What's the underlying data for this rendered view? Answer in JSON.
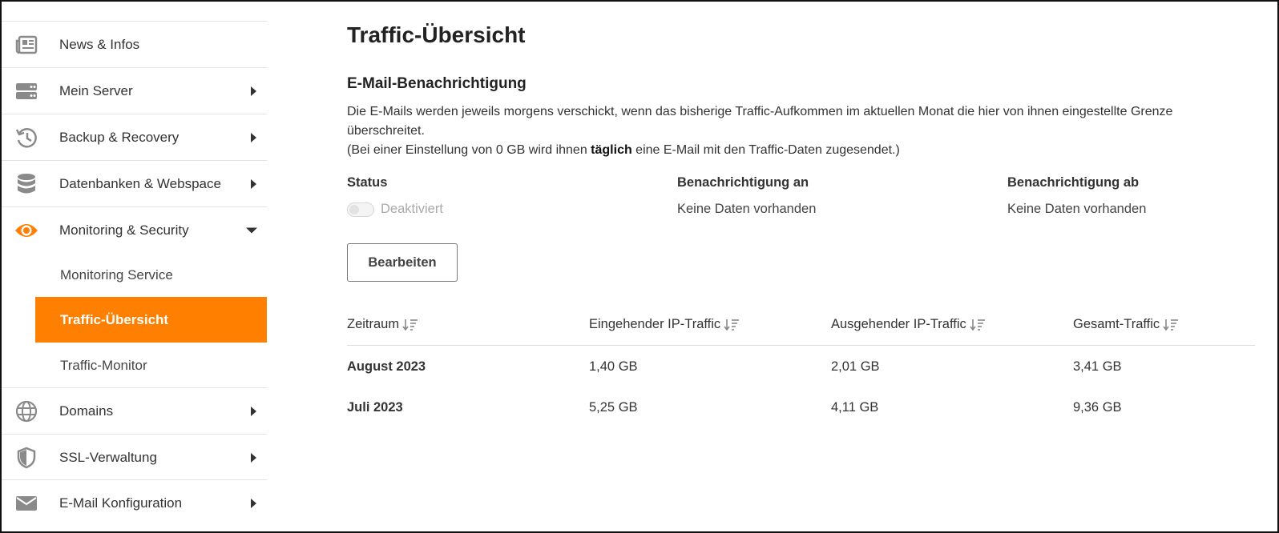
{
  "sidebar": {
    "items": [
      {
        "label": "News & Infos",
        "icon": "newspaper-icon"
      },
      {
        "label": "Mein Server",
        "icon": "server-icon"
      },
      {
        "label": "Backup & Recovery",
        "icon": "history-icon"
      },
      {
        "label": "Datenbanken & Webspace",
        "icon": "database-icon"
      },
      {
        "label": "Monitoring & Security",
        "icon": "eye-icon"
      },
      {
        "label": "Domains",
        "icon": "globe-icon"
      },
      {
        "label": "SSL-Verwaltung",
        "icon": "shield-icon"
      },
      {
        "label": "E-Mail Konfiguration",
        "icon": "envelope-icon"
      }
    ],
    "subitems": [
      {
        "label": "Monitoring Service",
        "active": false
      },
      {
        "label": "Traffic-Übersicht",
        "active": true
      },
      {
        "label": "Traffic-Monitor",
        "active": false
      }
    ]
  },
  "main": {
    "title": "Traffic-Übersicht",
    "section_title": "E-Mail-Benachrichtigung",
    "desc_line1": "Die E-Mails werden jeweils morgens verschickt, wenn das bisherige Traffic-Aufkommen im aktuellen Monat die hier von ihnen eingestellte Grenze überschreitet.",
    "desc_line2_pre": "(Bei einer Einstellung von 0 GB wird ihnen ",
    "desc_line2_bold": "täglich",
    "desc_line2_post": " eine E-Mail mit den Traffic-Daten zugesendet.)",
    "status": {
      "status_header": "Status",
      "status_value": "Deaktiviert",
      "notify_on_header": "Benachrichtigung an",
      "notify_on_value": "Keine Daten vorhanden",
      "notify_off_header": "Benachrichtigung ab",
      "notify_off_value": "Keine Daten vorhanden"
    },
    "edit_button": "Bearbeiten",
    "table": {
      "headers": [
        "Zeitraum",
        "Eingehender IP-Traffic",
        "Ausgehender IP-Traffic",
        "Gesamt-Traffic"
      ],
      "rows": [
        [
          "August 2023",
          "1,40 GB",
          "2,01 GB",
          "3,41 GB"
        ],
        [
          "Juli 2023",
          "5,25 GB",
          "4,11 GB",
          "9,36 GB"
        ]
      ]
    }
  },
  "colors": {
    "accent": "#ff7f00",
    "icon_gray": "#8a8a8a"
  }
}
